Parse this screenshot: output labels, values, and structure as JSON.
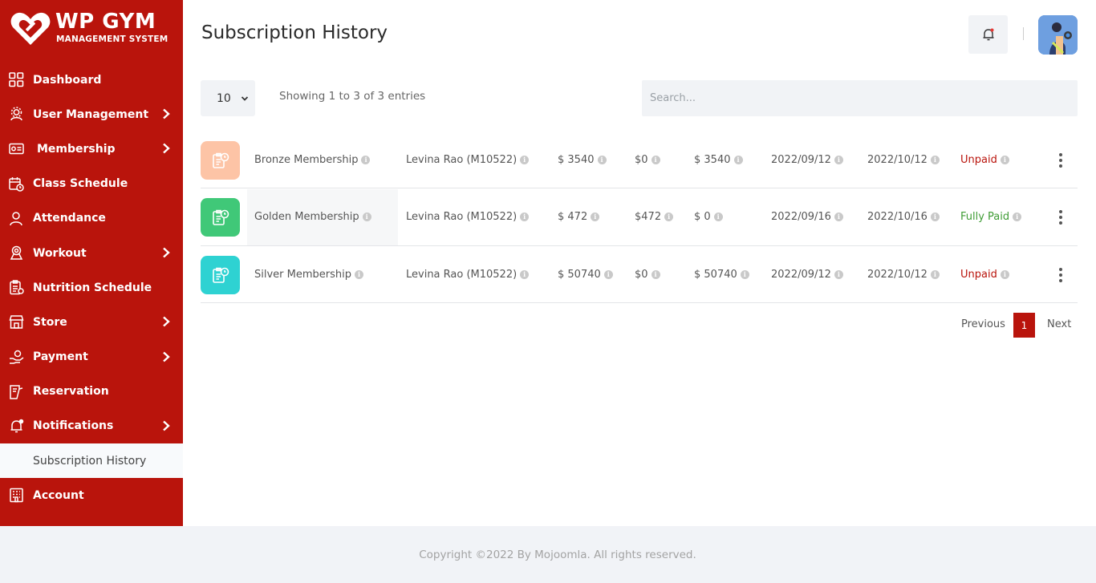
{
  "brand": {
    "title": "WP GYM",
    "subtitle": "MANAGEMENT SYSTEM"
  },
  "sidebar": {
    "items": [
      {
        "label": "Dashboard",
        "icon": "grid-icon",
        "has_submenu": false
      },
      {
        "label": "User Management",
        "icon": "users-gear-icon",
        "has_submenu": true
      },
      {
        "label": "Membership",
        "icon": "membership-card-icon",
        "has_submenu": true
      },
      {
        "label": "Class Schedule",
        "icon": "calendar-clock-icon",
        "has_submenu": false
      },
      {
        "label": "Attendance",
        "icon": "user-check-icon",
        "has_submenu": false
      },
      {
        "label": "Workout",
        "icon": "dumbbell-icon",
        "has_submenu": true
      },
      {
        "label": "Nutrition Schedule",
        "icon": "nutrition-clipboard-icon",
        "has_submenu": false
      },
      {
        "label": "Store",
        "icon": "store-icon",
        "has_submenu": true
      },
      {
        "label": "Payment",
        "icon": "payment-hand-icon",
        "has_submenu": true
      },
      {
        "label": "Reservation",
        "icon": "reservation-icon",
        "has_submenu": false
      },
      {
        "label": "Notifications",
        "icon": "bell-icon",
        "has_submenu": true
      },
      {
        "label": "Subscription History",
        "icon": "history-icon",
        "has_submenu": false,
        "active": true
      },
      {
        "label": "Account",
        "icon": "account-building-icon",
        "has_submenu": false
      }
    ]
  },
  "header": {
    "title": "Subscription History"
  },
  "table_controls": {
    "length_value": "10",
    "info": "Showing 1 to 3 of 3 entries",
    "search_placeholder": "Search..."
  },
  "rows": [
    {
      "membership": "Bronze Membership",
      "member": "Levina Rao (M10522)",
      "amount": "$ 3540",
      "paid": "$0",
      "due": "$ 3540",
      "start": "2022/09/12",
      "end": "2022/10/12",
      "status": "Unpaid",
      "icon_color": "#fdc4a6"
    },
    {
      "membership": "Golden Membership",
      "member": "Levina Rao (M10522)",
      "amount": "$ 472",
      "paid": "$472",
      "due": "$ 0",
      "start": "2022/09/16",
      "end": "2022/10/16",
      "status": "Fully Paid",
      "icon_color": "#40c878"
    },
    {
      "membership": "Silver Membership",
      "member": "Levina Rao (M10522)",
      "amount": "$ 50740",
      "paid": "$0",
      "due": "$ 50740",
      "start": "2022/09/12",
      "end": "2022/10/12",
      "status": "Unpaid",
      "icon_color": "#2ed2d2"
    }
  ],
  "pagination": {
    "previous": "Previous",
    "current": "1",
    "next": "Next"
  },
  "footer": {
    "text": "Copyright ©2022 By Mojoomla. All rights reserved."
  },
  "colors": {
    "brand_red": "#b9140c",
    "paid_green": "#3f9c35",
    "light_bg": "#f1f3f6"
  }
}
